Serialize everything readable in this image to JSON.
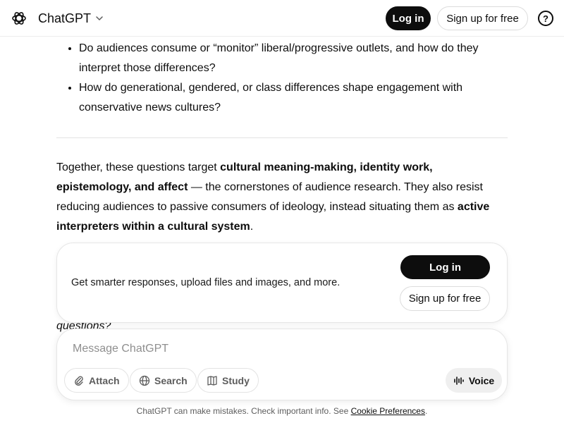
{
  "header": {
    "app_title": "ChatGPT",
    "login_label": "Log in",
    "signup_label": "Sign up for free",
    "help_glyph": "?"
  },
  "content": {
    "bullets": [
      "Do audiences consume or “monitor” liberal/progressive outlets, and how do they interpret those differences?",
      "How do generational, gendered, or class differences shape engagement with conservative news cultures?"
    ],
    "paragraph": {
      "t1": "Together, these questions target ",
      "b1": "cultural meaning-making, identity work, epistemology, and affect",
      "t2": " — the cornerstones of audience research. They also resist reducing audiences to passive consumers of ideology, instead situating them as ",
      "b2": "active interpreters within a cultural system",
      "t3": "."
    },
    "partially_hidden_text": "questions?"
  },
  "promo": {
    "text": "Get smarter responses, upload files and images, and more.",
    "login_label": "Log in",
    "signup_label": "Sign up for free"
  },
  "composer": {
    "placeholder": "Message ChatGPT",
    "attach_label": "Attach",
    "search_label": "Search",
    "study_label": "Study",
    "voice_label": "Voice"
  },
  "footer": {
    "text": "ChatGPT can make mistakes. Check important info. See ",
    "link_label": "Cookie Preferences",
    "end": "."
  },
  "icons": {
    "logo": "openai-logo-icon",
    "chevron": "chevron-down-icon",
    "help": "help-icon",
    "attach": "paperclip-icon",
    "search": "globe-icon",
    "study": "book-icon",
    "voice": "waveform-icon"
  }
}
